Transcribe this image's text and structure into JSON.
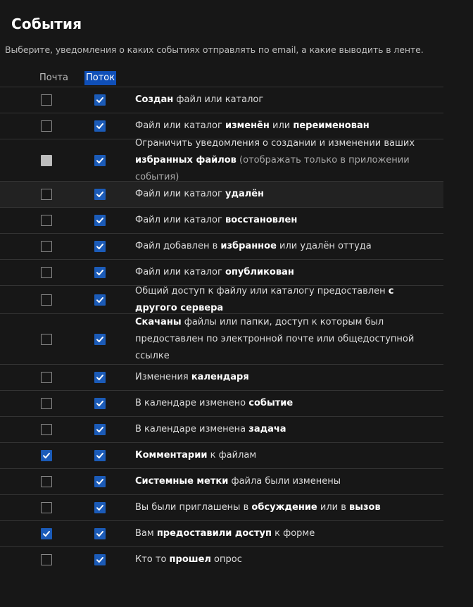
{
  "title": "События",
  "hint": "Выберите, уведомления о каких событиях отправлять по email, а какие выводить в ленте.",
  "columns": {
    "mail": "Почта",
    "stream": "Поток"
  },
  "rows": [
    {
      "id": "created",
      "mail": "unchecked",
      "stream": "checked",
      "parts": [
        [
          "b",
          "Создан"
        ],
        [
          "t",
          " файл или каталог"
        ]
      ]
    },
    {
      "id": "changed",
      "mail": "unchecked",
      "stream": "checked",
      "parts": [
        [
          "t",
          "Файл или каталог "
        ],
        [
          "b",
          "изменён"
        ],
        [
          "t",
          " или "
        ],
        [
          "b",
          "переименован"
        ]
      ]
    },
    {
      "id": "favorites-limit",
      "mail": "disabled",
      "stream": "checked",
      "parts": [
        [
          "t",
          "Ограничить уведомления о создании и изменении ваших "
        ],
        [
          "b",
          "избранных файлов"
        ],
        [
          "m",
          " (отображать только в приложении события)"
        ]
      ]
    },
    {
      "id": "deleted",
      "mail": "unchecked",
      "stream": "checked",
      "highlight": true,
      "parts": [
        [
          "t",
          "Файл или каталог "
        ],
        [
          "b",
          "удалён"
        ]
      ]
    },
    {
      "id": "restored",
      "mail": "unchecked",
      "stream": "checked",
      "parts": [
        [
          "t",
          "Файл или каталог "
        ],
        [
          "b",
          "восстановлен"
        ]
      ]
    },
    {
      "id": "favorite",
      "mail": "unchecked",
      "stream": "checked",
      "parts": [
        [
          "t",
          "Файл добавлен в "
        ],
        [
          "b",
          "избранное"
        ],
        [
          "t",
          " или удалён оттуда"
        ]
      ]
    },
    {
      "id": "published",
      "mail": "unchecked",
      "stream": "checked",
      "parts": [
        [
          "t",
          "Файл или каталог "
        ],
        [
          "b",
          "опубликован"
        ]
      ]
    },
    {
      "id": "remote-share",
      "mail": "unchecked",
      "stream": "checked",
      "parts": [
        [
          "t",
          "Общий доступ к файлу или каталогу предоставлен "
        ],
        [
          "b",
          "с другого сервера"
        ]
      ]
    },
    {
      "id": "downloaded",
      "mail": "unchecked",
      "stream": "checked",
      "parts": [
        [
          "b",
          "Скачаны"
        ],
        [
          "t",
          " файлы или папки, доступ к которым был предоставлен по электронной почте или общедоступной ссылке"
        ]
      ]
    },
    {
      "id": "calendar",
      "mail": "unchecked",
      "stream": "checked",
      "parts": [
        [
          "t",
          "Изменения "
        ],
        [
          "b",
          "календаря"
        ]
      ]
    },
    {
      "id": "calendar-event",
      "mail": "unchecked",
      "stream": "checked",
      "parts": [
        [
          "t",
          "В календаре изменено "
        ],
        [
          "b",
          "событие"
        ]
      ]
    },
    {
      "id": "calendar-todo",
      "mail": "unchecked",
      "stream": "checked",
      "parts": [
        [
          "t",
          "В календаре изменена "
        ],
        [
          "b",
          "задача"
        ]
      ]
    },
    {
      "id": "comments",
      "mail": "checked",
      "stream": "checked",
      "parts": [
        [
          "b",
          "Комментарии"
        ],
        [
          "t",
          " к файлам"
        ]
      ]
    },
    {
      "id": "systemtags",
      "mail": "unchecked",
      "stream": "checked",
      "parts": [
        [
          "b",
          "Системные метки"
        ],
        [
          "t",
          " файла были изменены"
        ]
      ]
    },
    {
      "id": "talk",
      "mail": "unchecked",
      "stream": "checked",
      "parts": [
        [
          "t",
          "Вы были приглашены в "
        ],
        [
          "b",
          "обсуждение"
        ],
        [
          "t",
          " или в "
        ],
        [
          "b",
          "вызов"
        ]
      ]
    },
    {
      "id": "forms-shared",
      "mail": "checked",
      "stream": "checked",
      "parts": [
        [
          "t",
          "Вам "
        ],
        [
          "b",
          "предоставили доступ"
        ],
        [
          "t",
          " к форме"
        ]
      ]
    },
    {
      "id": "forms-answered",
      "mail": "unchecked",
      "stream": "checked",
      "parts": [
        [
          "t",
          "Кто то "
        ],
        [
          "b",
          "прошел"
        ],
        [
          "t",
          " опрос"
        ]
      ]
    }
  ]
}
